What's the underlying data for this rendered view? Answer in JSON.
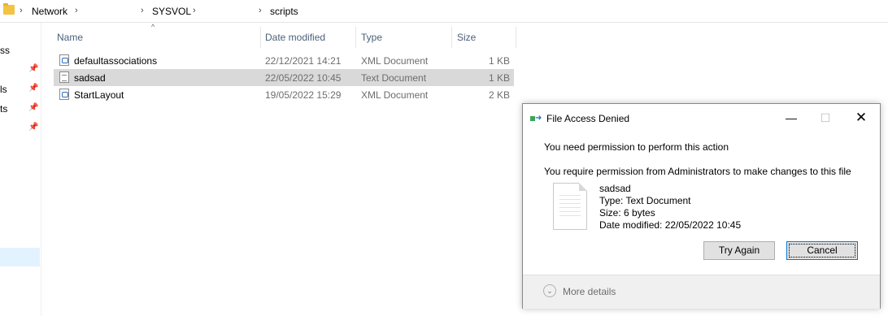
{
  "breadcrumb": {
    "items": [
      "Network",
      "SYSVOL",
      "scripts"
    ],
    "separator": "›"
  },
  "nav": {
    "fragments": [
      "ss",
      "ls",
      "ts"
    ]
  },
  "columns": {
    "name": "Name",
    "date": "Date modified",
    "type": "Type",
    "size": "Size"
  },
  "files": [
    {
      "name": "defaultassociations",
      "date": "22/12/2021 14:21",
      "type": "XML Document",
      "size": "1 KB",
      "icon": "xml-file-icon"
    },
    {
      "name": "sadsad",
      "date": "22/05/2022 10:45",
      "type": "Text Document",
      "size": "1 KB",
      "icon": "text-file-icon",
      "selected": true
    },
    {
      "name": "StartLayout",
      "date": "19/05/2022 15:29",
      "type": "XML Document",
      "size": "2 KB",
      "icon": "xml-file-icon"
    }
  ],
  "dialog": {
    "title": "File Access Denied",
    "message": "You need permission to perform this action",
    "detail": "You require permission from Administrators to make changes to this file",
    "file_name": "sadsad",
    "file_type": "Type: Text Document",
    "file_size": "Size: 6 bytes",
    "file_modified": "Date modified: 22/05/2022 10:45",
    "try_again": "Try Again",
    "cancel": "Cancel",
    "more_details": "More details",
    "close_symbol": "✕",
    "minimize_symbol": "—",
    "maximize_symbol": "☐"
  },
  "colors": {
    "selected_row": "#d9d9d9",
    "header_text": "#4c607a",
    "accent": "#0078d7"
  }
}
